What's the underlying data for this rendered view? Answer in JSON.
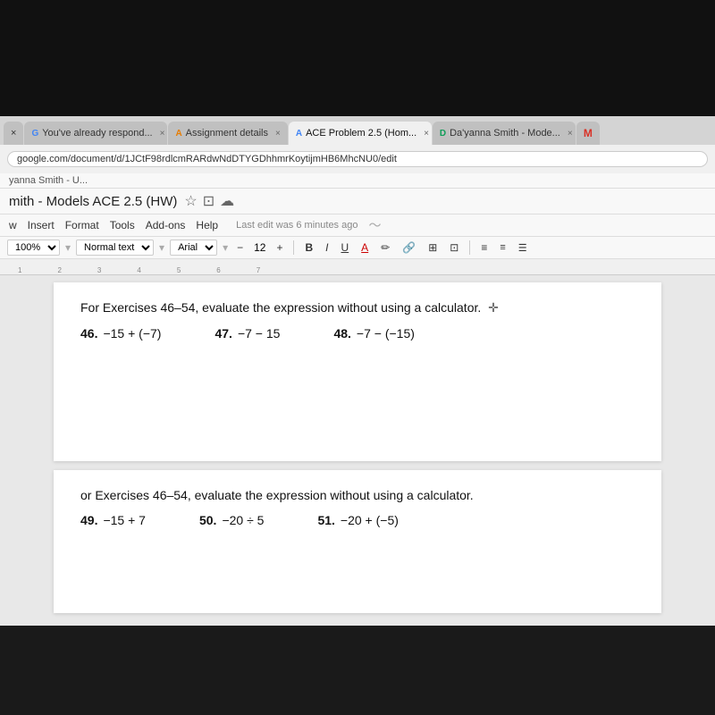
{
  "top_dark_height": 130,
  "browser": {
    "tabs": [
      {
        "id": "tab-1",
        "label": "×",
        "active": false,
        "icon": "doc-icon",
        "text": "×"
      },
      {
        "id": "tab-2",
        "label": "You've already respond...",
        "active": false,
        "icon": "gdoc-icon",
        "close": "×"
      },
      {
        "id": "tab-3",
        "label": "Assignment details",
        "active": false,
        "icon": "assignment-icon",
        "close": "×"
      },
      {
        "id": "tab-4",
        "label": "ACE Problem 2.5 (Hom...",
        "active": true,
        "icon": "ace-icon",
        "close": "×"
      },
      {
        "id": "tab-5",
        "label": "Da'yanna Smith - Mode...",
        "active": false,
        "icon": "gdoc2-icon",
        "close": "×"
      },
      {
        "id": "tab-6",
        "label": "M",
        "active": false,
        "icon": "gmail-icon"
      }
    ],
    "address": "google.com/document/d/1JCtF98rdlcmRARdwNdDTYGDhhmrKoytijmHB6MhcNU0/edit",
    "tab_partial": "yanna Smith - U..."
  },
  "document": {
    "title": "mith - Models ACE 2.5 (HW)",
    "menus": [
      "w",
      "Insert",
      "Format",
      "Tools",
      "Add-ons",
      "Help"
    ],
    "last_edit": "Last edit was 6 minutes ago",
    "formatting": {
      "zoom": "100%",
      "style": "Normal text",
      "font": "Arial",
      "size": "12",
      "bold": "B",
      "italic": "I",
      "underline": "U",
      "color": "A"
    },
    "ruler_marks": [
      "1",
      "2",
      "3",
      "4",
      "5",
      "6",
      "7"
    ],
    "section1": {
      "instruction": "For Exercises 46–54, evaluate the expression without using a calculator.",
      "exercises": [
        {
          "num": "46.",
          "expr": "−15 + (−7)"
        },
        {
          "num": "47.",
          "expr": "−7 − 15"
        },
        {
          "num": "48.",
          "expr": "−7 − (−15)"
        }
      ]
    },
    "section2": {
      "instruction": "or Exercises 46–54, evaluate the expression without using a calculator.",
      "exercises": [
        {
          "num": "49.",
          "expr": "−15 + 7"
        },
        {
          "num": "50.",
          "expr": "−20 ÷ 5"
        },
        {
          "num": "51.",
          "expr": "−20 + (−5)"
        }
      ]
    }
  }
}
